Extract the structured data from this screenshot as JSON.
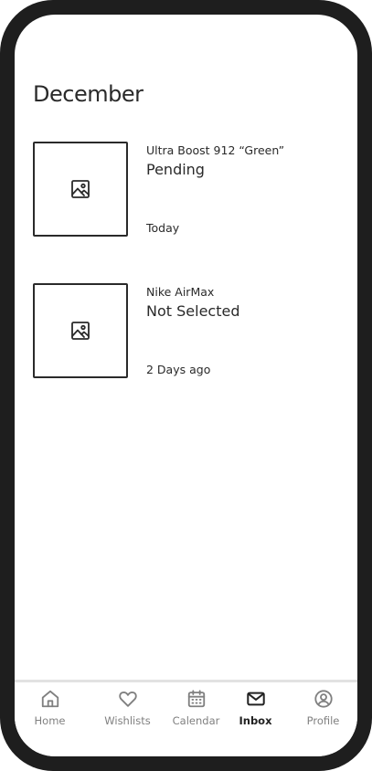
{
  "section": {
    "title": "December"
  },
  "items": [
    {
      "name": "Ultra Boost 912 “Green”",
      "status": "Pending",
      "time": "Today",
      "thumbnail_icon": "image-icon"
    },
    {
      "name": "Nike AirMax",
      "status": "Not Selected",
      "time": "2 Days ago",
      "thumbnail_icon": "image-icon"
    }
  ],
  "tabbar": {
    "active": "Inbox",
    "tabs": [
      {
        "label": "Home",
        "icon": "home-icon"
      },
      {
        "label": "Wishlists",
        "icon": "heart-icon"
      },
      {
        "label": "Calendar",
        "icon": "calendar-icon"
      },
      {
        "label": "Inbox",
        "icon": "mail-icon"
      },
      {
        "label": "Profile",
        "icon": "profile-icon"
      }
    ]
  },
  "colors": {
    "frame": "#1e1e1e",
    "text": "#2a2a2a",
    "tab_inactive": "#808080",
    "tab_active": "#222222"
  }
}
